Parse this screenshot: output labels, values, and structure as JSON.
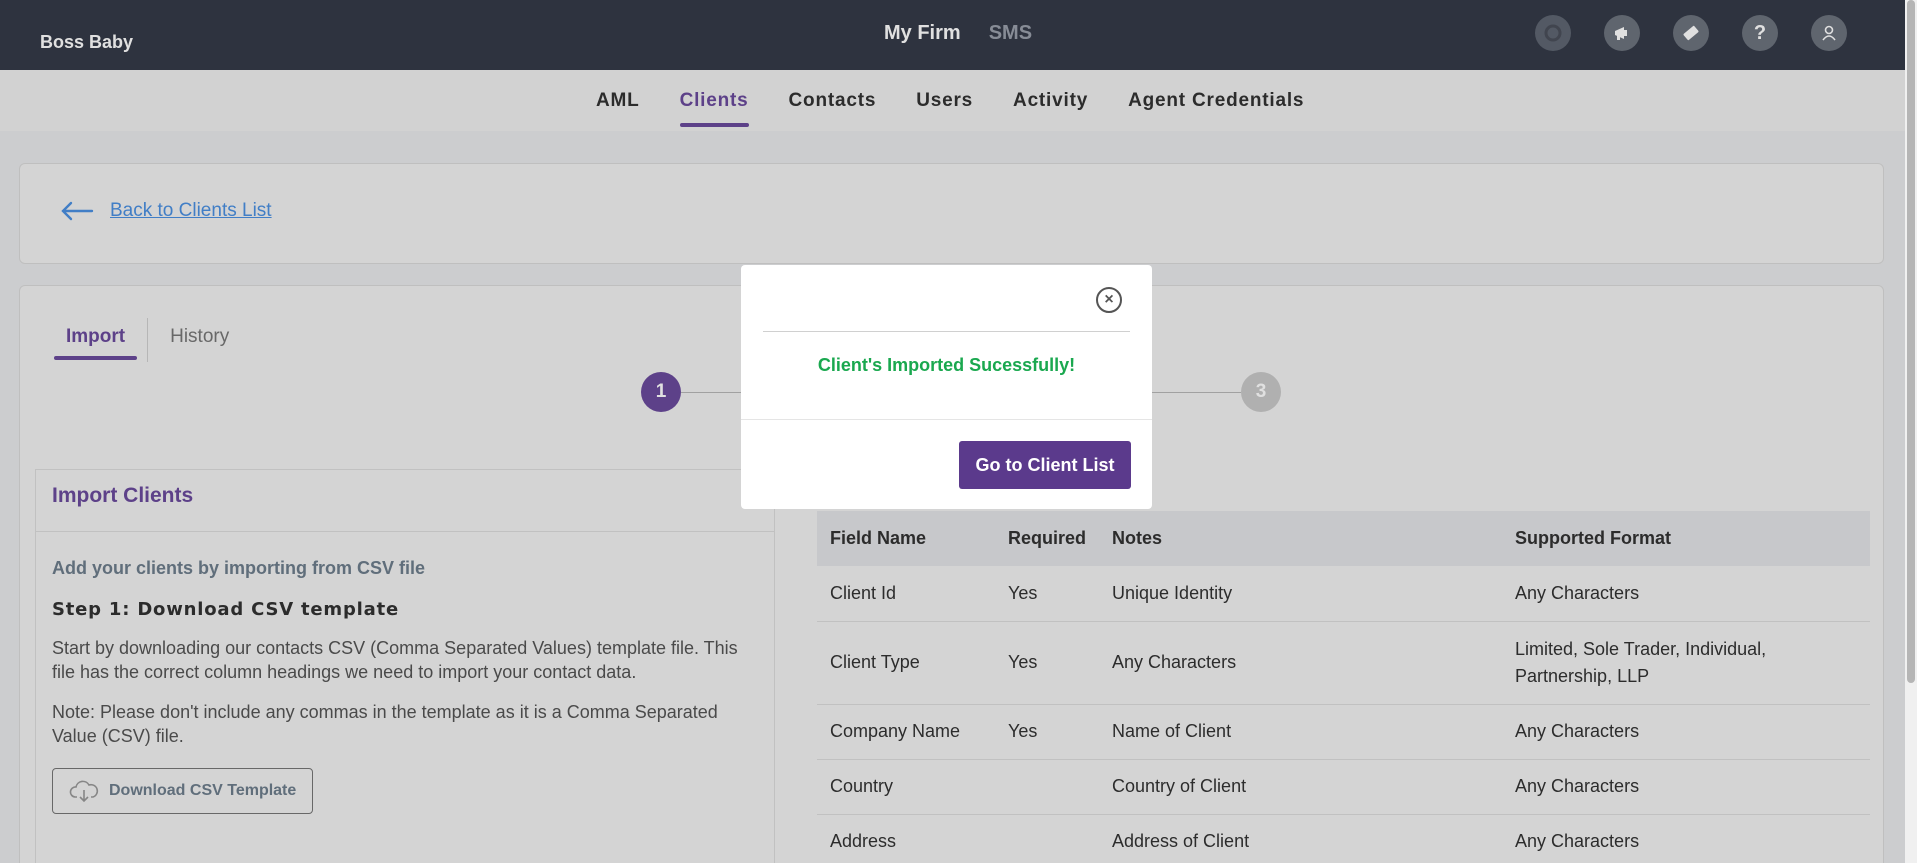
{
  "header": {
    "brand": "Boss Baby",
    "tabs": [
      {
        "label": "My Firm",
        "active": true
      },
      {
        "label": "SMS",
        "active": false
      }
    ],
    "icons": [
      "g-logo-icon",
      "megaphone-icon",
      "ticket-icon",
      "help-icon",
      "user-icon"
    ]
  },
  "subnav": {
    "items": [
      "AML",
      "Clients",
      "Contacts",
      "Users",
      "Activity",
      "Agent Credentials"
    ],
    "active": "Clients"
  },
  "back": {
    "label": "Back to Clients List"
  },
  "tabs": {
    "import": "Import",
    "history": "History"
  },
  "stepper": {
    "step1": "1",
    "step3": "3"
  },
  "import_panel": {
    "title": "Import Clients",
    "subtitle": "Add your clients by importing from CSV file",
    "step_title": "Step 1: Download CSV template",
    "para1": "Start by downloading our contacts CSV (Comma Separated Values) template file. This file has the correct column headings we need to import your contact data.",
    "para2": "Note: Please don't include any commas in the template as it is a Comma Separated Value (CSV) file.",
    "download_label": "Download CSV Template"
  },
  "table": {
    "headers": [
      "Field Name",
      "Required",
      "Notes",
      "Supported Format"
    ],
    "rows": [
      [
        "Client Id",
        "Yes",
        "Unique Identity",
        "Any Characters"
      ],
      [
        "Client Type",
        "Yes",
        "Any Characters",
        " Limited, Sole Trader, Individual, Partnership, LLP"
      ],
      [
        "Company Name",
        "Yes",
        " Name of Client",
        "Any Characters"
      ],
      [
        "Country",
        "",
        "Country of Client",
        "Any Characters"
      ],
      [
        "Address",
        "",
        "Address of Client",
        "Any Characters"
      ]
    ]
  },
  "modal": {
    "message": "Client's Imported Sucessfully!",
    "button": "Go to Client List"
  }
}
